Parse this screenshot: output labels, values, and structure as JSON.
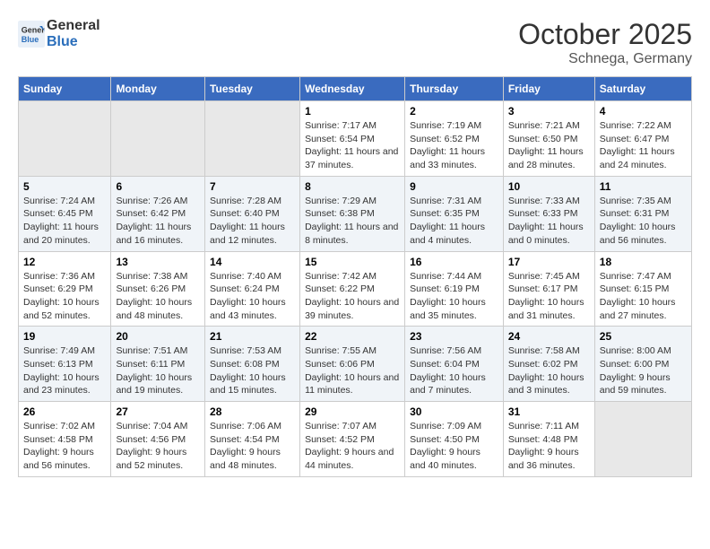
{
  "header": {
    "logo_line1": "General",
    "logo_line2": "Blue",
    "month": "October 2025",
    "location": "Schnega, Germany"
  },
  "weekdays": [
    "Sunday",
    "Monday",
    "Tuesday",
    "Wednesday",
    "Thursday",
    "Friday",
    "Saturday"
  ],
  "weeks": [
    [
      {
        "day": "",
        "empty": true
      },
      {
        "day": "",
        "empty": true
      },
      {
        "day": "",
        "empty": true
      },
      {
        "day": "1",
        "sunrise": "Sunrise: 7:17 AM",
        "sunset": "Sunset: 6:54 PM",
        "daylight": "Daylight: 11 hours and 37 minutes."
      },
      {
        "day": "2",
        "sunrise": "Sunrise: 7:19 AM",
        "sunset": "Sunset: 6:52 PM",
        "daylight": "Daylight: 11 hours and 33 minutes."
      },
      {
        "day": "3",
        "sunrise": "Sunrise: 7:21 AM",
        "sunset": "Sunset: 6:50 PM",
        "daylight": "Daylight: 11 hours and 28 minutes."
      },
      {
        "day": "4",
        "sunrise": "Sunrise: 7:22 AM",
        "sunset": "Sunset: 6:47 PM",
        "daylight": "Daylight: 11 hours and 24 minutes."
      }
    ],
    [
      {
        "day": "5",
        "sunrise": "Sunrise: 7:24 AM",
        "sunset": "Sunset: 6:45 PM",
        "daylight": "Daylight: 11 hours and 20 minutes."
      },
      {
        "day": "6",
        "sunrise": "Sunrise: 7:26 AM",
        "sunset": "Sunset: 6:42 PM",
        "daylight": "Daylight: 11 hours and 16 minutes."
      },
      {
        "day": "7",
        "sunrise": "Sunrise: 7:28 AM",
        "sunset": "Sunset: 6:40 PM",
        "daylight": "Daylight: 11 hours and 12 minutes."
      },
      {
        "day": "8",
        "sunrise": "Sunrise: 7:29 AM",
        "sunset": "Sunset: 6:38 PM",
        "daylight": "Daylight: 11 hours and 8 minutes."
      },
      {
        "day": "9",
        "sunrise": "Sunrise: 7:31 AM",
        "sunset": "Sunset: 6:35 PM",
        "daylight": "Daylight: 11 hours and 4 minutes."
      },
      {
        "day": "10",
        "sunrise": "Sunrise: 7:33 AM",
        "sunset": "Sunset: 6:33 PM",
        "daylight": "Daylight: 11 hours and 0 minutes."
      },
      {
        "day": "11",
        "sunrise": "Sunrise: 7:35 AM",
        "sunset": "Sunset: 6:31 PM",
        "daylight": "Daylight: 10 hours and 56 minutes."
      }
    ],
    [
      {
        "day": "12",
        "sunrise": "Sunrise: 7:36 AM",
        "sunset": "Sunset: 6:29 PM",
        "daylight": "Daylight: 10 hours and 52 minutes."
      },
      {
        "day": "13",
        "sunrise": "Sunrise: 7:38 AM",
        "sunset": "Sunset: 6:26 PM",
        "daylight": "Daylight: 10 hours and 48 minutes."
      },
      {
        "day": "14",
        "sunrise": "Sunrise: 7:40 AM",
        "sunset": "Sunset: 6:24 PM",
        "daylight": "Daylight: 10 hours and 43 minutes."
      },
      {
        "day": "15",
        "sunrise": "Sunrise: 7:42 AM",
        "sunset": "Sunset: 6:22 PM",
        "daylight": "Daylight: 10 hours and 39 minutes."
      },
      {
        "day": "16",
        "sunrise": "Sunrise: 7:44 AM",
        "sunset": "Sunset: 6:19 PM",
        "daylight": "Daylight: 10 hours and 35 minutes."
      },
      {
        "day": "17",
        "sunrise": "Sunrise: 7:45 AM",
        "sunset": "Sunset: 6:17 PM",
        "daylight": "Daylight: 10 hours and 31 minutes."
      },
      {
        "day": "18",
        "sunrise": "Sunrise: 7:47 AM",
        "sunset": "Sunset: 6:15 PM",
        "daylight": "Daylight: 10 hours and 27 minutes."
      }
    ],
    [
      {
        "day": "19",
        "sunrise": "Sunrise: 7:49 AM",
        "sunset": "Sunset: 6:13 PM",
        "daylight": "Daylight: 10 hours and 23 minutes."
      },
      {
        "day": "20",
        "sunrise": "Sunrise: 7:51 AM",
        "sunset": "Sunset: 6:11 PM",
        "daylight": "Daylight: 10 hours and 19 minutes."
      },
      {
        "day": "21",
        "sunrise": "Sunrise: 7:53 AM",
        "sunset": "Sunset: 6:08 PM",
        "daylight": "Daylight: 10 hours and 15 minutes."
      },
      {
        "day": "22",
        "sunrise": "Sunrise: 7:55 AM",
        "sunset": "Sunset: 6:06 PM",
        "daylight": "Daylight: 10 hours and 11 minutes."
      },
      {
        "day": "23",
        "sunrise": "Sunrise: 7:56 AM",
        "sunset": "Sunset: 6:04 PM",
        "daylight": "Daylight: 10 hours and 7 minutes."
      },
      {
        "day": "24",
        "sunrise": "Sunrise: 7:58 AM",
        "sunset": "Sunset: 6:02 PM",
        "daylight": "Daylight: 10 hours and 3 minutes."
      },
      {
        "day": "25",
        "sunrise": "Sunrise: 8:00 AM",
        "sunset": "Sunset: 6:00 PM",
        "daylight": "Daylight: 9 hours and 59 minutes."
      }
    ],
    [
      {
        "day": "26",
        "sunrise": "Sunrise: 7:02 AM",
        "sunset": "Sunset: 4:58 PM",
        "daylight": "Daylight: 9 hours and 56 minutes."
      },
      {
        "day": "27",
        "sunrise": "Sunrise: 7:04 AM",
        "sunset": "Sunset: 4:56 PM",
        "daylight": "Daylight: 9 hours and 52 minutes."
      },
      {
        "day": "28",
        "sunrise": "Sunrise: 7:06 AM",
        "sunset": "Sunset: 4:54 PM",
        "daylight": "Daylight: 9 hours and 48 minutes."
      },
      {
        "day": "29",
        "sunrise": "Sunrise: 7:07 AM",
        "sunset": "Sunset: 4:52 PM",
        "daylight": "Daylight: 9 hours and 44 minutes."
      },
      {
        "day": "30",
        "sunrise": "Sunrise: 7:09 AM",
        "sunset": "Sunset: 4:50 PM",
        "daylight": "Daylight: 9 hours and 40 minutes."
      },
      {
        "day": "31",
        "sunrise": "Sunrise: 7:11 AM",
        "sunset": "Sunset: 4:48 PM",
        "daylight": "Daylight: 9 hours and 36 minutes."
      },
      {
        "day": "",
        "empty": true
      }
    ]
  ]
}
